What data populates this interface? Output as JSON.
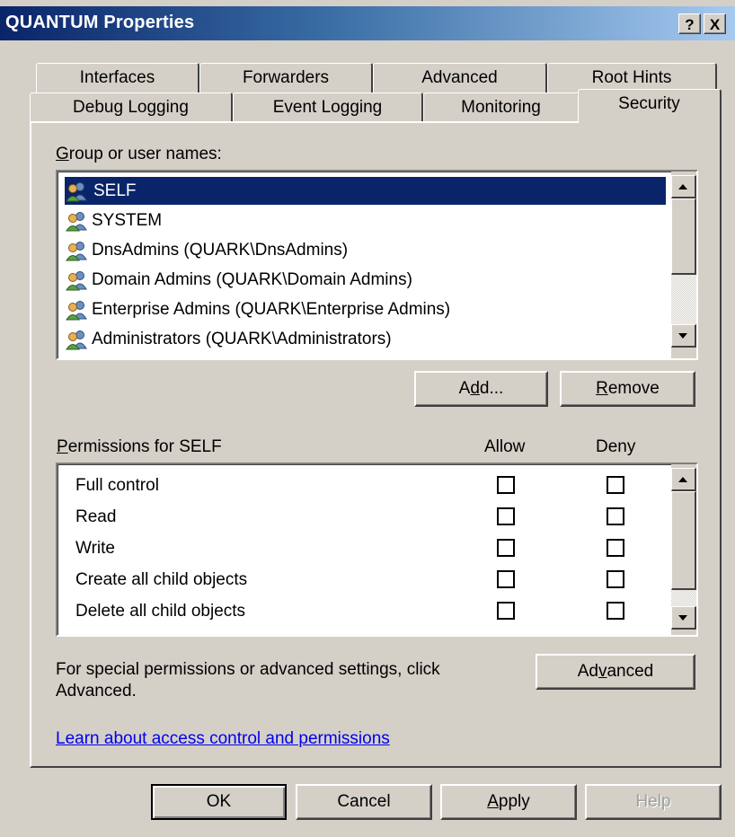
{
  "window": {
    "title": "QUANTUM Properties",
    "help_btn": "?",
    "close_btn": "X"
  },
  "tabs_back": [
    "Interfaces",
    "Forwarders",
    "Advanced",
    "Root Hints"
  ],
  "tabs_front": [
    "Debug Logging",
    "Event Logging",
    "Monitoring",
    "Security"
  ],
  "active_tab": "Security",
  "group_label": {
    "mnemonic": "G",
    "rest": "roup or user names:"
  },
  "users": [
    {
      "name": "SELF",
      "selected": true
    },
    {
      "name": "SYSTEM",
      "selected": false
    },
    {
      "name": "DnsAdmins (QUARK\\DnsAdmins)",
      "selected": false
    },
    {
      "name": "Domain Admins (QUARK\\Domain Admins)",
      "selected": false
    },
    {
      "name": "Enterprise Admins (QUARK\\Enterprise Admins)",
      "selected": false
    },
    {
      "name": "Administrators (QUARK\\Administrators)",
      "selected": false
    }
  ],
  "add_button": {
    "pre": "A",
    "mnemonic": "d",
    "post": "d..."
  },
  "remove_button": {
    "mnemonic": "R",
    "rest": "emove"
  },
  "permissions_label": {
    "mnemonic": "P",
    "rest": "ermissions for SELF"
  },
  "allow_header": "Allow",
  "deny_header": "Deny",
  "permissions": [
    {
      "name": "Full control",
      "allow": false,
      "deny": false
    },
    {
      "name": "Read",
      "allow": false,
      "deny": false
    },
    {
      "name": "Write",
      "allow": false,
      "deny": false
    },
    {
      "name": "Create all child objects",
      "allow": false,
      "deny": false
    },
    {
      "name": "Delete all child objects",
      "allow": false,
      "deny": false
    }
  ],
  "special_text_1": "For special permissions or advanced settings, click",
  "special_text_2": "Advanced.",
  "advanced_button": {
    "pre": "Ad",
    "mnemonic": "v",
    "post": "anced"
  },
  "learn_link": "Learn about access control and permissions",
  "ok_button": "OK",
  "cancel_button": "Cancel",
  "apply_button": {
    "mnemonic": "A",
    "rest": "pply"
  },
  "help_button": "Help",
  "colors": {
    "selection": "#0a246a",
    "face": "#d4d0c8",
    "link": "#0000ee"
  }
}
